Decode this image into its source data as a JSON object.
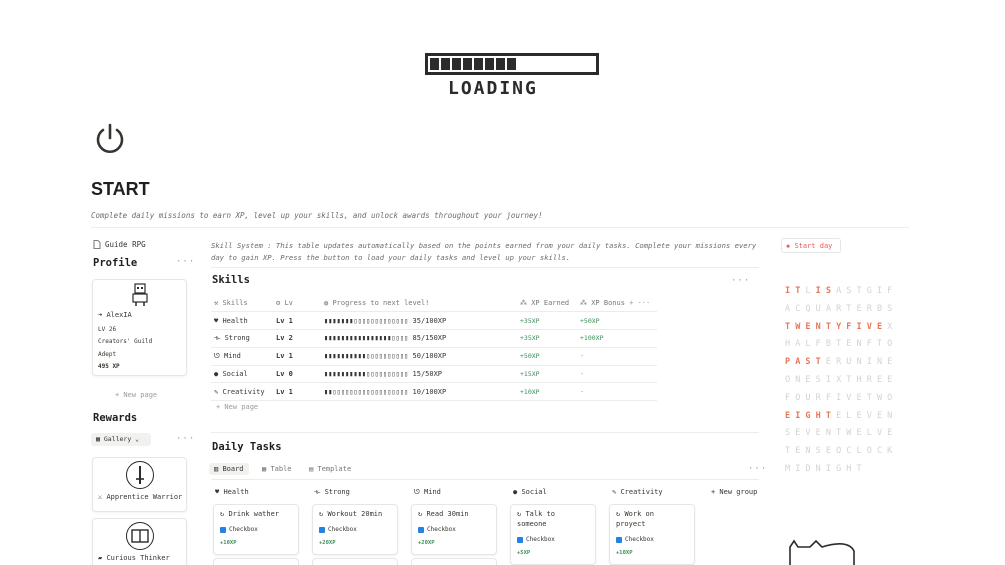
{
  "cover": {
    "loading_text": "LOADING",
    "loading_segments": 8
  },
  "page": {
    "title": "START",
    "description": "Complete daily missions to earn XP, level up your skills, and unlock awards throughout your journey!"
  },
  "left": {
    "guide_label": "Guide RPG",
    "profile_title": "Profile",
    "profile": {
      "name": "AlexIA",
      "level": "LV 26",
      "guild": "Creators' Guild",
      "rank": "Adept",
      "xp": "495 XP"
    },
    "new_page": "+ New page",
    "rewards_title": "Rewards",
    "gallery_label": "Gallery",
    "rewards": [
      {
        "label": "Apprentice Warrior",
        "icon": "sword-icon"
      },
      {
        "label": "Curious Thinker",
        "icon": "book-icon"
      }
    ]
  },
  "skills": {
    "note": "Skill System : This table updates automatically based on the points earned from your daily tasks. Complete your missions every day to gain XP. Press the button to load your daily tasks and level up your skills.",
    "title": "Skills",
    "headers": {
      "skills": "Skills",
      "lv": "Lv",
      "progress": "Progress to next level!",
      "earned": "XP Earned",
      "bonus": "XP Bonus"
    },
    "rows": [
      {
        "name": "Health",
        "lv": "Lv 1",
        "bar": "▮▮▮▮▮▮▮▯▯▯▯▯▯▯▯▯▯▯▯▯",
        "progress": "35/100XP",
        "earned": "+35XP",
        "bonus": "+50XP"
      },
      {
        "name": "Strong",
        "lv": "Lv 2",
        "bar": "▮▮▮▮▮▮▮▮▮▮▮▮▮▮▮▮▯▯▯▯",
        "progress": "85/150XP",
        "earned": "+35XP",
        "bonus": "+100XP"
      },
      {
        "name": "Mind",
        "lv": "Lv 1",
        "bar": "▮▮▮▮▮▮▮▮▮▮▯▯▯▯▯▯▯▯▯▯",
        "progress": "50/100XP",
        "earned": "+50XP",
        "bonus": "-"
      },
      {
        "name": "Social",
        "lv": "Lv 0",
        "bar": "▮▮▮▮▮▮▮▮▮▮▯▯▯▯▯▯▯▯▯▯",
        "progress": "15/50XP",
        "earned": "+15XP",
        "bonus": "-"
      },
      {
        "name": "Creativity",
        "lv": "Lv 1",
        "bar": "▮▮▯▯▯▯▯▯▯▯▯▯▯▯▯▯▯▯▯▯",
        "progress": "10/100XP",
        "earned": "+10XP",
        "bonus": "-"
      }
    ],
    "new_page": "+ New page"
  },
  "daily": {
    "title": "Daily Tasks",
    "views": [
      "Board",
      "Table",
      "Template"
    ],
    "new_group": "+ New group",
    "columns": [
      {
        "name": "Health",
        "task": "Drink wather",
        "xp": "+10XP"
      },
      {
        "name": "Strong",
        "task": "Workout 20min",
        "xp": "+20XP"
      },
      {
        "name": "Mind",
        "task": "Read 30min",
        "xp": "+20XP"
      },
      {
        "name": "Social",
        "task": "Talk to someone",
        "xp": "+5XP"
      },
      {
        "name": "Creativity",
        "task": "Work on proyect",
        "xp": "+10XP"
      }
    ],
    "checkbox_label": "Checkbox"
  },
  "right": {
    "start_day": "Start day",
    "word_clock": [
      "ITLISASTGIF",
      "ACQUARTERBS",
      "TWENTYFIVEX",
      "HALFBTENFTO",
      "PASTERUNINE",
      "ONESIXTHREE",
      "FOURFIVETWO",
      "EIGHTELEVEN",
      "SEVENTWELVE",
      "TENSEOCLOCK",
      "MIDNIGHT"
    ]
  },
  "colors": {
    "accent_green": "#3e8e5b",
    "accent_red": "#eb5757",
    "clock_on": "#e8765a"
  }
}
